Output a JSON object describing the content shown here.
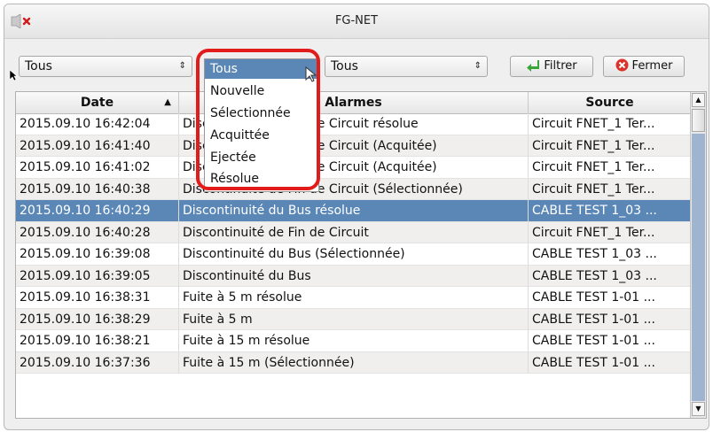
{
  "window": {
    "title": "FG-NET"
  },
  "filters": {
    "combo1": "Tous",
    "combo2": "Tous",
    "combo3": "Tous"
  },
  "toolbar": {
    "filter_label": "Filtrer",
    "close_label": "Fermer"
  },
  "dropdown": {
    "selected": "Tous",
    "options": [
      "Nouvelle",
      "Sélectionnée",
      "Acquittée",
      "Ejectée",
      "Résolue"
    ]
  },
  "table": {
    "headers": {
      "date": "Date",
      "alarms": "Alarmes",
      "source": "Source"
    },
    "rows": [
      {
        "date": "2015.09.10 16:42:04",
        "alarm": "Discontinuité de Fin de Circuit résolue",
        "source": "Circuit FNET_1 Ter..."
      },
      {
        "date": "2015.09.10 16:41:40",
        "alarm": "Discontinuité de Fin de Circuit (Acquitée)",
        "source": "Circuit FNET_1 Ter..."
      },
      {
        "date": "2015.09.10 16:41:02",
        "alarm": "Discontinuité de Fin de Circuit (Acquitée)",
        "source": "Circuit FNET_1 Ter..."
      },
      {
        "date": "2015.09.10 16:40:38",
        "alarm": "Discontinuité de Fin de Circuit (Sélectionnée)",
        "source": "Circuit FNET_1 Ter..."
      },
      {
        "date": "2015.09.10 16:40:29",
        "alarm": "Discontinuité du Bus résolue",
        "source": "CABLE TEST 1_03 ..."
      },
      {
        "date": "2015.09.10 16:40:28",
        "alarm": "Discontinuité de Fin de Circuit",
        "source": "Circuit FNET_1 Ter..."
      },
      {
        "date": "2015.09.10 16:39:08",
        "alarm": "Discontinuité du Bus (Sélectionnée)",
        "source": "CABLE TEST 1_03 ..."
      },
      {
        "date": "2015.09.10 16:39:05",
        "alarm": "Discontinuité du Bus",
        "source": "CABLE TEST 1_03 ..."
      },
      {
        "date": "2015.09.10 16:38:31",
        "alarm": "Fuite à 5 m  résolue",
        "source": "CABLE TEST 1-01 ..."
      },
      {
        "date": "2015.09.10 16:38:29",
        "alarm": "Fuite à 5 m",
        "source": "CABLE TEST 1-01 ..."
      },
      {
        "date": "2015.09.10 16:38:21",
        "alarm": "Fuite à 15 m  résolue",
        "source": "CABLE TEST 1-01 ..."
      },
      {
        "date": "2015.09.10 16:37:36",
        "alarm": "Fuite à 15 m  (Sélectionnée)",
        "source": "CABLE TEST 1-01 ..."
      }
    ]
  },
  "colors": {
    "selection": "#5b87b7",
    "highlight": "#e21b1b",
    "filter_icon": "#3aa53a",
    "close_icon": "#d9332b"
  },
  "icons": {
    "filter": "green-arrow-icon",
    "close": "red-x-circle-icon",
    "window": "close-x-icon"
  }
}
